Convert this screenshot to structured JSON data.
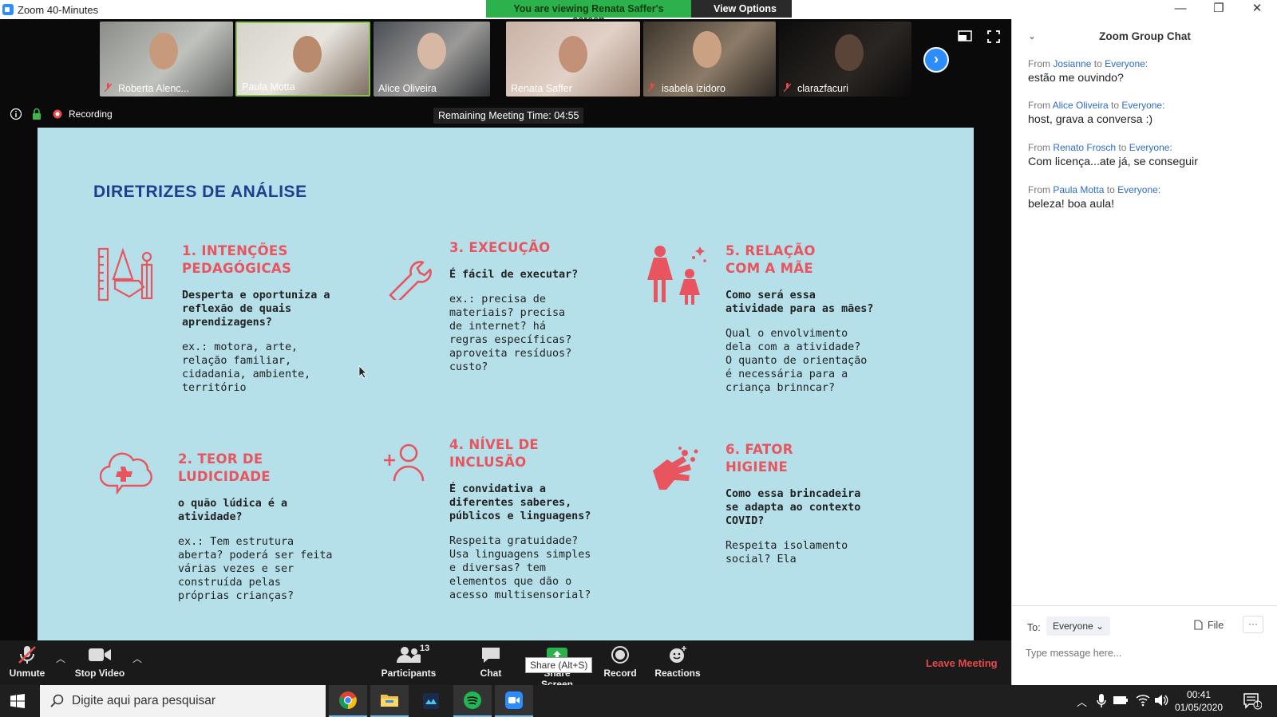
{
  "window": {
    "title": "Zoom 40-Minutes",
    "minimize": "—",
    "restore": "❐",
    "close": "✕"
  },
  "share_banner": {
    "viewing_text": "You are viewing Renata Saffer's screen",
    "view_options_label": "View Options ⌄"
  },
  "participants_strip": [
    {
      "name": "Roberta Alenc...",
      "muted": true
    },
    {
      "name": "Paula Motta",
      "muted": false
    },
    {
      "name": "Alice Oliveira",
      "muted": false
    },
    {
      "name": "Renata Saffer",
      "muted": false
    },
    {
      "name": "isabela izidoro",
      "muted": true
    },
    {
      "name": "clarazfacuri",
      "muted": true
    }
  ],
  "meeting_status": {
    "recording_label": "Recording",
    "remaining_time": "Remaining Meeting Time: 04:55"
  },
  "slide": {
    "title": "DIRETRIZES DE ANÁLISE",
    "sections": [
      {
        "heading": "1. INTENÇÕES\nPEDAGÓGICAS",
        "question": "Desperta e oportuniza a\nreflexão de quais\naprendizagens?",
        "example": "ex.: motora, arte,\nrelação familiar,\ncidadania, ambiente,\nterritório"
      },
      {
        "heading": "3. EXECUÇÃO",
        "question": "É fácil de executar?",
        "example": "ex.: precisa de\nmateriais? precisa\nde internet? há\nregras específicas?\naproveita resíduos?\ncusto?"
      },
      {
        "heading": "5. RELAÇÃO\nCOM A MÃE",
        "question": "Como será essa\natividade para as mães?",
        "example": "Qual o envolvimento\ndela com a atividade?\nO quanto de orientação\né necessária para a\ncriança brinncar?"
      },
      {
        "heading": "2. TEOR DE\nLUDICIDADE",
        "question": "o quão lúdica é a\natividade?",
        "example": "ex.: Tem estrutura\naberta? poderá ser feita\nvárias vezes e ser\nconstruída pelas\npróprias crianças?"
      },
      {
        "heading": "4. NÍVEL DE\nINCLUSÃO",
        "question": "É convidativa a\ndiferentes saberes,\npúblicos e linguagens?",
        "example": "Respeita gratuidade?\nUsa linguagens simples\ne diversas? tem\nelementos que dão o\nacesso multisensorial?"
      },
      {
        "heading": "6. FATOR\nHIGIENE",
        "question": "Como essa brincadeira\nse adapta ao contexto\nCOVID?",
        "example": "Respeita isolamento\nsocial? Ela"
      }
    ],
    "colors": {
      "background": "#b5dfe9",
      "title": "#1d3f8f",
      "heading": "#e8555f"
    }
  },
  "chat": {
    "title": "Zoom Group Chat",
    "messages": [
      {
        "from_label": "From",
        "sender": "Josianne",
        "to_label": "to",
        "recipient": "Everyone:",
        "text": "estão me ouvindo?"
      },
      {
        "from_label": "From",
        "sender": "Alice Oliveira",
        "to_label": "to",
        "recipient": "Everyone:",
        "text": "host, grava a conversa :)"
      },
      {
        "from_label": "From",
        "sender": "Renato Frosch",
        "to_label": "to",
        "recipient": "Everyone:",
        "text": "Com licença...ate já, se conseguir"
      },
      {
        "from_label": "From",
        "sender": "Paula Motta",
        "to_label": "to",
        "recipient": "Everyone:",
        "text": "beleza! boa aula!"
      }
    ],
    "to_label": "To:",
    "to_value": "Everyone ⌄",
    "file_label": "File",
    "more_label": "···",
    "input_placeholder": "Type message here..."
  },
  "toolbar": {
    "unmute": "Unmute",
    "stop_video": "Stop Video",
    "participants": "Participants",
    "participants_count": "13",
    "chat": "Chat",
    "share_screen": "Share Screen",
    "share_tooltip": "Share (Alt+S)",
    "record": "Record",
    "reactions": "Reactions",
    "leave": "Leave Meeting"
  },
  "taskbar": {
    "search_placeholder": "Digite aqui para pesquisar",
    "time": "00:41",
    "date": "01/05/2020",
    "notification_count": "1"
  }
}
